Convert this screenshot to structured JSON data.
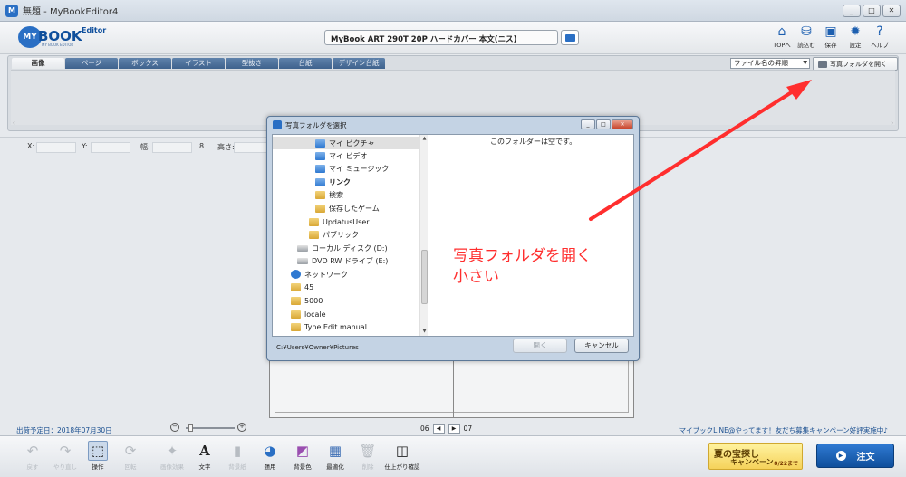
{
  "window": {
    "title": "無題 - MyBookEditor4",
    "controls": [
      "_",
      "□",
      "✕"
    ]
  },
  "header": {
    "logo": {
      "my": "MY",
      "book": "BOOK",
      "editor": "Editor",
      "sub": "MY BOOK EDITOR"
    },
    "product": "MyBook ART 290T 20P ハードカバー 本文(ニス)",
    "menu": [
      {
        "label": "TOPへ",
        "icon": "home-icon"
      },
      {
        "label": "読込む",
        "icon": "load-icon"
      },
      {
        "label": "保存",
        "icon": "save-icon"
      },
      {
        "label": "設定",
        "icon": "gear-icon"
      },
      {
        "label": "ヘルプ",
        "icon": "help-icon"
      }
    ]
  },
  "panel": {
    "tabs": [
      "画像",
      "ページ",
      "ボックス",
      "イラスト",
      "型抜き",
      "台紙",
      "デザイン台紙"
    ],
    "sort": "ファイル名の昇順",
    "open_folder": "写真フォルダを開く"
  },
  "coords": {
    "x": "X:",
    "y": "Y:",
    "w": "幅:",
    "h": "高さ:"
  },
  "status": {
    "ship_date": "出荷予定日：2018年07月30日",
    "page_left": "06",
    "page_right": "07",
    "notice": "マイブックLINE@やってます！友だち募集キャンペーン好評実施中♪"
  },
  "toolbar": {
    "items": [
      {
        "label": "戻す",
        "icon": "undo-icon",
        "state": "disabled"
      },
      {
        "label": "やり直し",
        "icon": "redo-icon",
        "state": "disabled"
      },
      {
        "label": "操作",
        "icon": "pointer-icon",
        "state": "selected"
      },
      {
        "label": "回転",
        "icon": "rotate-icon",
        "state": "disabled"
      },
      {
        "label": "画像効果",
        "icon": "image-effect-icon",
        "state": "disabled"
      },
      {
        "label": "文字",
        "icon": "text-icon",
        "state": "normal"
      },
      {
        "label": "背景紙",
        "icon": "background-paper-icon",
        "state": "disabled"
      },
      {
        "label": "題用",
        "icon": "globe-icon",
        "state": "normal"
      },
      {
        "label": "背景色",
        "icon": "background-color-icon",
        "state": "normal"
      },
      {
        "label": "最適化",
        "icon": "optimize-icon",
        "state": "normal"
      },
      {
        "label": "削除",
        "icon": "trash-icon",
        "state": "disabled"
      },
      {
        "label": "仕上がり確認",
        "icon": "book-preview-icon",
        "state": "normal"
      }
    ],
    "promo": {
      "line1": "夏の宝探し",
      "line2": "キャンペーン",
      "date": "8/22まで"
    },
    "order": "注文"
  },
  "dialog": {
    "title": "写真フォルダを選択",
    "tree": [
      {
        "label": "マイ ピクチャ",
        "type": "special",
        "selected": true
      },
      {
        "label": "マイ ビデオ",
        "type": "special"
      },
      {
        "label": "マイ ミュージック",
        "type": "special"
      },
      {
        "label": "リンク",
        "type": "special",
        "bold": true
      },
      {
        "label": "検索",
        "type": "folder"
      },
      {
        "label": "保存したゲーム",
        "type": "folder"
      },
      {
        "label": "UpdatusUser",
        "type": "folder"
      },
      {
        "label": "パブリック",
        "type": "folder"
      },
      {
        "label": "ローカル ディスク (D:)",
        "type": "drive"
      },
      {
        "label": "DVD RW ドライブ (E:)",
        "type": "drive"
      },
      {
        "label": "ネットワーク",
        "type": "network"
      },
      {
        "label": "45",
        "type": "folder"
      },
      {
        "label": "5000",
        "type": "folder"
      },
      {
        "label": "locale",
        "type": "folder"
      },
      {
        "label": "Type Edit manual",
        "type": "folder"
      }
    ],
    "empty": "このフォルダーは空です。",
    "path": "C:¥Users¥Owner¥Pictures",
    "open_btn": "開く",
    "cancel_btn": "キャンセル"
  },
  "annotation": {
    "line1": "写真フォルダを開く",
    "line2": "小さい",
    "color": "#ff2e2e"
  }
}
